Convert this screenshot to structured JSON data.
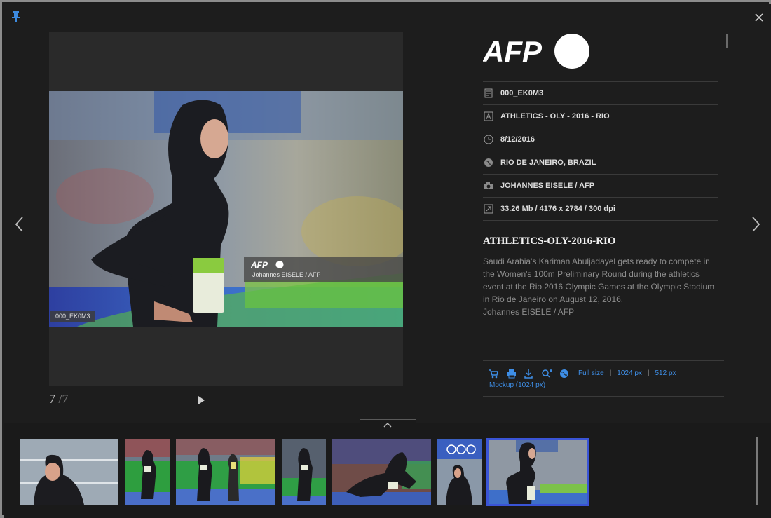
{
  "viewer": {
    "pin_icon": "pin-icon",
    "close_icon": "close-icon",
    "prev_icon": "chevron-left-icon",
    "next_icon": "chevron-right-icon",
    "counter_current": "7",
    "counter_total": "/7",
    "play_icon": "play-icon"
  },
  "photo": {
    "overlay_credit": "Johannes EISELE / AFP",
    "overlay_id": "000_EK0M3"
  },
  "info": {
    "meta": [
      {
        "icon": "document-icon",
        "text": "000_EK0M3"
      },
      {
        "icon": "title-icon",
        "text": "ATHLETICS - OLY - 2016 - RIO"
      },
      {
        "icon": "clock-icon",
        "text": "8/12/2016"
      },
      {
        "icon": "globe-icon",
        "text": "RIO DE JANEIRO, BRAZIL"
      },
      {
        "icon": "camera-icon",
        "text": "JOHANNES EISELE / AFP"
      },
      {
        "icon": "resize-icon",
        "text": "33.26 Mb / 4176 x 2784 / 300 dpi"
      }
    ],
    "caption_title": "ATHLETICS-OLY-2016-RIO",
    "caption_lines": [
      "Saudi Arabia's Kariman Abuljadayel gets ready to compete in",
      "the Women's 100m Preliminary Round during the athletics",
      "event at the Rio 2016 Olympic Games at the Olympic Stadium",
      "in Rio de Janeiro on August 12, 2016.",
      "Johannes EISELE / AFP"
    ]
  },
  "actions": {
    "icons": [
      "cart-icon",
      "print-icon",
      "download-icon",
      "zoom-in-icon",
      "globe-icon"
    ],
    "links": {
      "full": "Full size",
      "px1024": "1024 px",
      "px512": "512 px",
      "mockup": "Mockup (1024 px)"
    },
    "separator": "|"
  },
  "colors": {
    "accent_link": "#3e8ee6",
    "selection": "#3a54d6",
    "pin": "#3d8be0"
  }
}
